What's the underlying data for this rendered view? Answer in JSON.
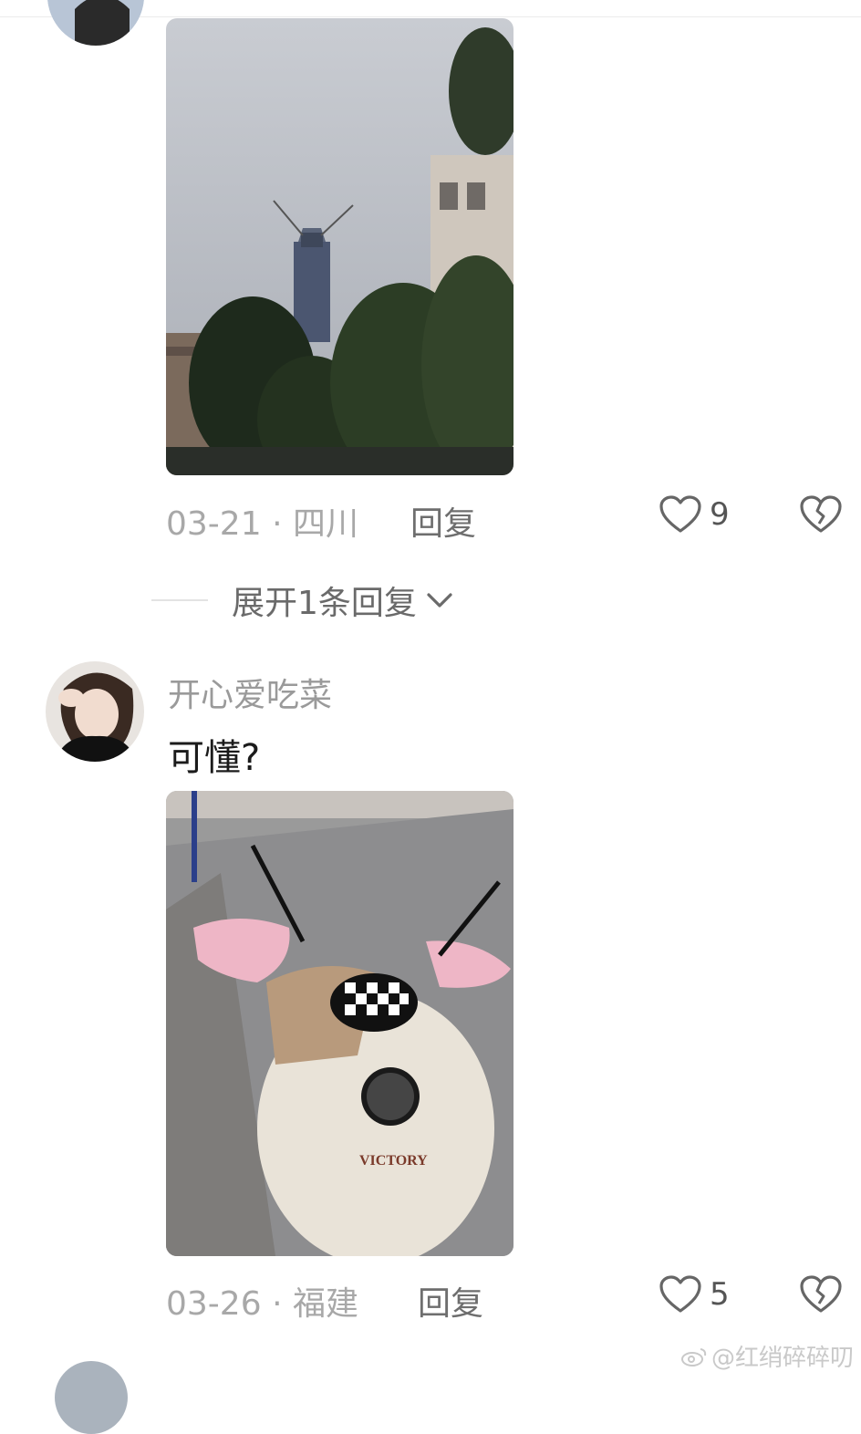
{
  "comments": [
    {
      "date": "03-21",
      "separator": "·",
      "location": "四川",
      "reply_label": "回复",
      "like_count": "9",
      "photo_icon": "image-photo-tower",
      "expand_label": "展开1条回复"
    },
    {
      "username": "开心爱吃菜",
      "text": "可懂?",
      "date": "03-26",
      "separator": "·",
      "location": "福建",
      "reply_label": "回复",
      "like_count": "5",
      "photo_icon": "image-photo-scooter",
      "scooter_text": "VICTORY"
    }
  ],
  "watermark": "@红绡碎碎叨",
  "icons": [
    "heart-icon",
    "broken-heart-icon",
    "chevron-down-icon",
    "weibo-icon"
  ],
  "colors": {
    "meta": "#a8a8a8",
    "text": "#1b1b1b",
    "icon": "#6a6a6a"
  }
}
